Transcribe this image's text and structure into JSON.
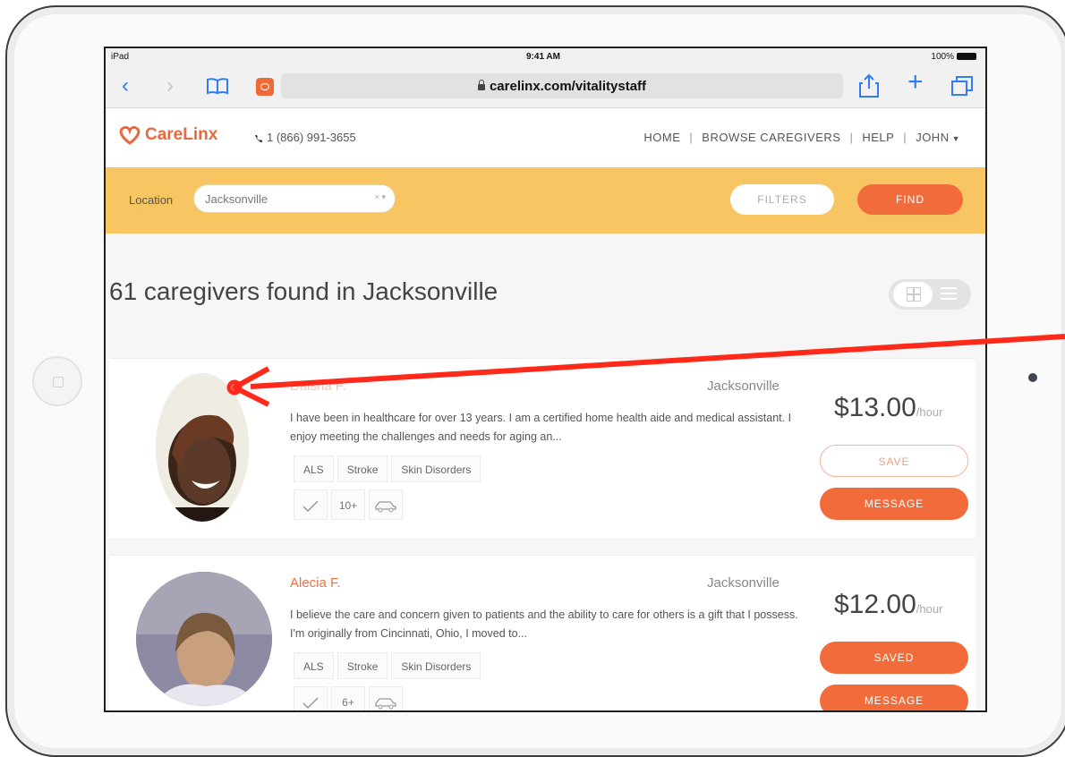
{
  "status_bar": {
    "carrier": "iPad",
    "time": "9:41 AM",
    "battery": "100%"
  },
  "browser": {
    "url": "carelinx.com/vitalitystaff"
  },
  "site": {
    "logo": "CareLinx",
    "phone": "1 (866) 991-3655",
    "nav": {
      "home": "HOME",
      "browse": "BROWSE CAREGIVERS",
      "help": "HELP",
      "user": "JOHN"
    }
  },
  "search": {
    "label": "Location",
    "value": "Jacksonville",
    "filters_label": "FILTERS",
    "find_label": "FIND"
  },
  "results": {
    "title": "61 caregivers found in Jacksonville"
  },
  "caregivers": [
    {
      "name": "Daisha F.",
      "city": "Jacksonville",
      "bio": "I have been in healthcare for over 13 years. I am a certified home health aide and medical assistant. I enjoy meeting the challenges and needs for aging an...",
      "tags": [
        "ALS",
        "Stroke",
        "Skin Disorders"
      ],
      "experience": "10+",
      "rate": "$13.00",
      "rate_unit": "/hour",
      "save_label": "SAVE",
      "message_label": "MESSAGE"
    },
    {
      "name": "Alecia F.",
      "city": "Jacksonville",
      "bio": "I believe the care and concern given to patients and the ability to care for others is a gift that I possess. I'm originally from Cincinnati, Ohio, I moved to...",
      "tags": [
        "ALS",
        "Stroke",
        "Skin Disorders"
      ],
      "experience": "6+",
      "rate": "$12.00",
      "rate_unit": "/hour",
      "save_label": "SAVED",
      "message_label": "MESSAGE"
    }
  ],
  "colors": {
    "accent": "#f26c3b",
    "search_band": "#f7c663",
    "annotation_arrow": "#ff2a1a"
  },
  "icons": [
    "back-icon",
    "forward-icon",
    "bookmarks-icon",
    "lock-icon",
    "reload-icon",
    "share-icon",
    "new-tab-icon",
    "tabs-icon",
    "phone-icon",
    "verified-check-icon",
    "car-icon",
    "grid-view-icon",
    "list-view-icon"
  ]
}
